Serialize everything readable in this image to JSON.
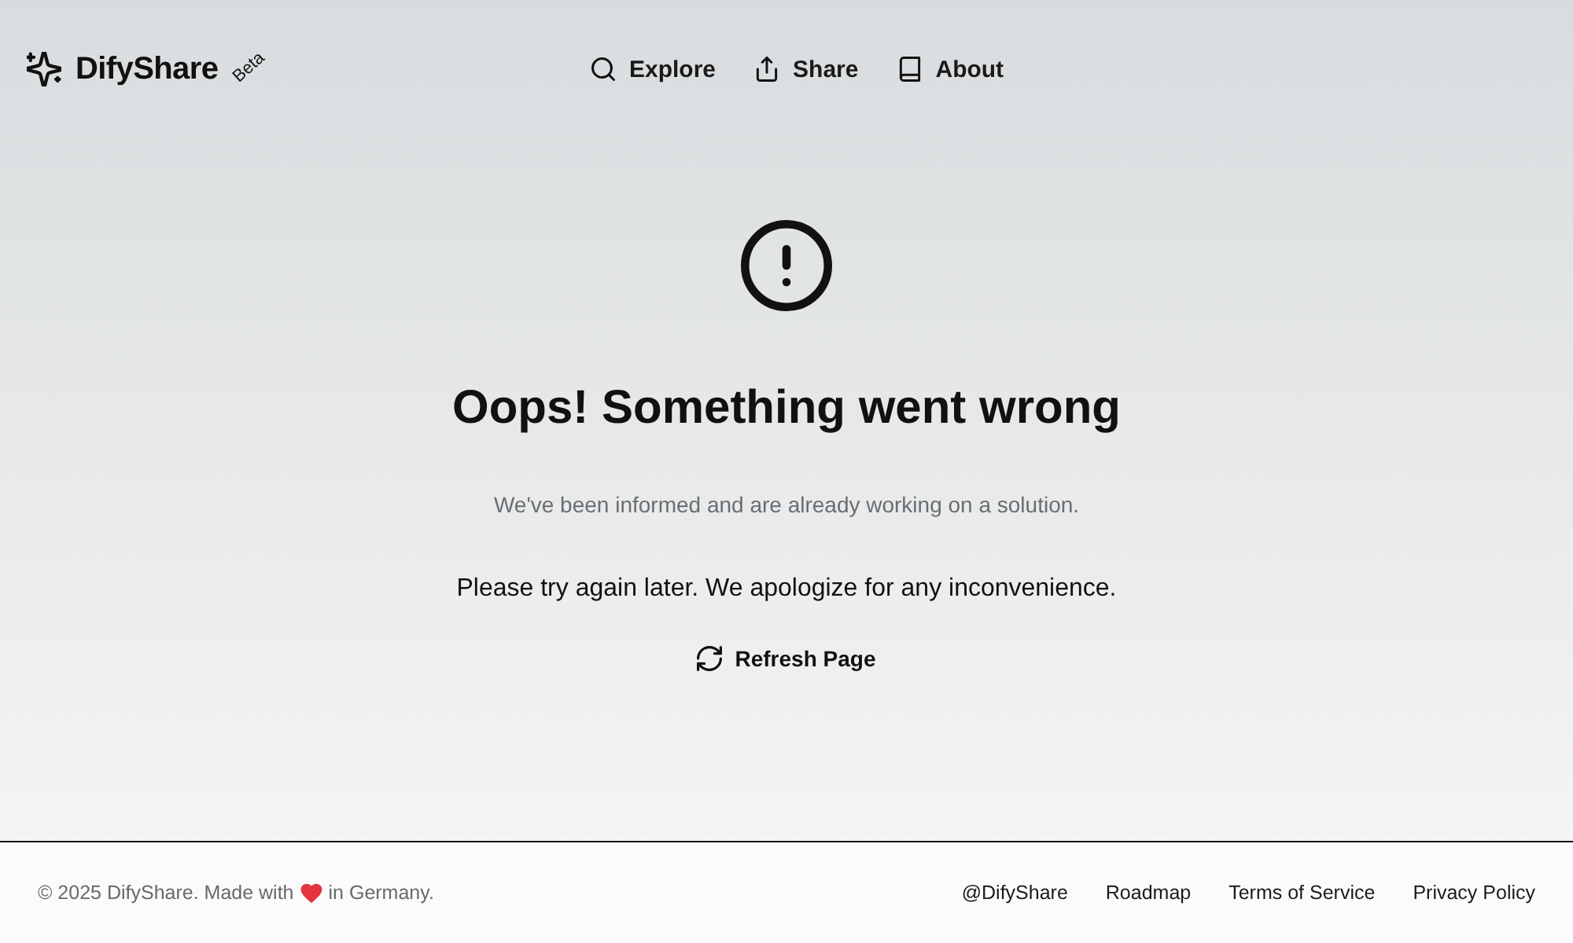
{
  "header": {
    "logo": {
      "name": "DifyShare",
      "badge": "Beta"
    },
    "nav": [
      {
        "label": "Explore"
      },
      {
        "label": "Share"
      },
      {
        "label": "About"
      }
    ]
  },
  "error": {
    "title": "Oops! Something went wrong",
    "message": "We've been informed and are already working on a solution.",
    "detail": "Please try again later. We apologize for any inconvenience.",
    "button": {
      "label": "Refresh Page"
    }
  },
  "footer": {
    "copyright_before": "© 2025 DifyShare. Made with",
    "copyright_after": "in Germany.",
    "links": [
      "@DifyShare",
      "Roadmap",
      "Terms of Service",
      "Privacy Policy"
    ]
  }
}
